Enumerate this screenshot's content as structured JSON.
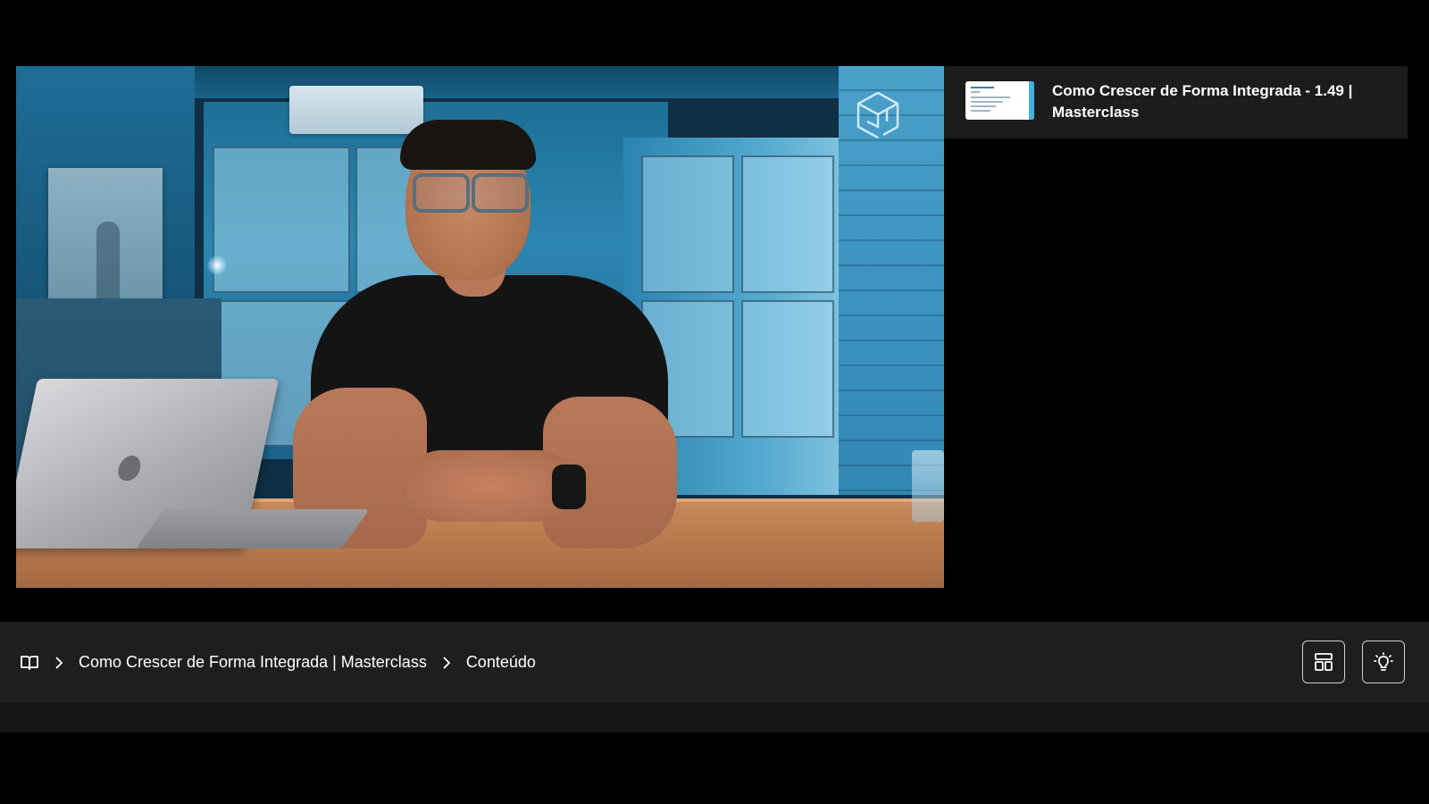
{
  "player": {
    "logo_icon": "cube-logo-icon"
  },
  "playlist": {
    "items": [
      {
        "title": "Como Crescer de Forma Integrada - 1.49 | Masterclass",
        "thumbnail": "slide-thumbnail"
      }
    ]
  },
  "breadcrumb": {
    "home_icon": "book-icon",
    "separator_icon": "chevron-right-icon",
    "items": [
      {
        "label": "Como Crescer de Forma Integrada | Masterclass"
      },
      {
        "label": "Conteúdo"
      }
    ]
  },
  "toolbar": {
    "layout_icon": "layout-icon",
    "theme_icon": "lightbulb-icon"
  },
  "colors": {
    "background": "#000000",
    "bar": "#1e1e1e",
    "panel": "#1c1c1c",
    "text": "#ffffff",
    "accent": "#3fb1e3"
  }
}
